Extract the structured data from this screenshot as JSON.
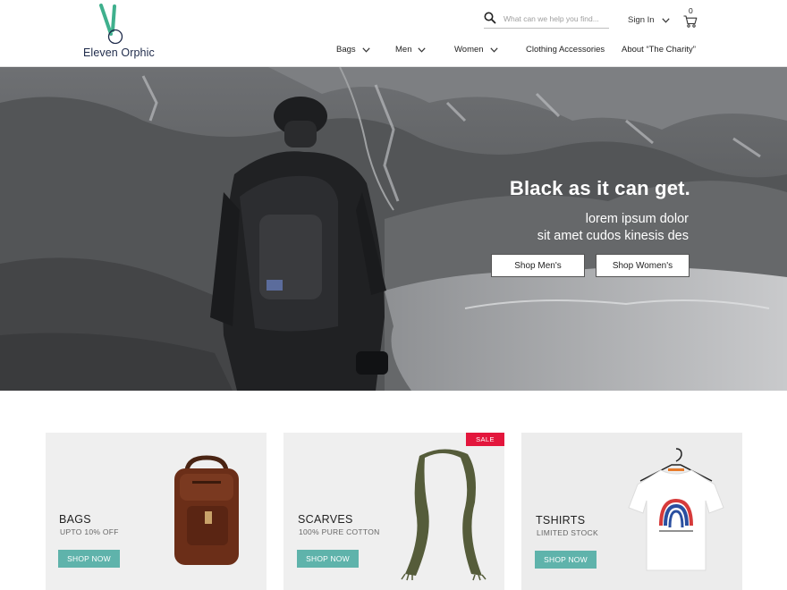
{
  "brand": {
    "name": "Eleven Orphic",
    "accent": "#3fb08d"
  },
  "header": {
    "search_placeholder": "What can we help you find...",
    "signin_label": "Sign In",
    "cart_count": "0"
  },
  "nav": {
    "items": [
      {
        "label": "Bags"
      },
      {
        "label": "Men"
      },
      {
        "label": "Women"
      },
      {
        "label": "Clothing Accessories"
      },
      {
        "label": "About “The Charity”"
      }
    ]
  },
  "hero": {
    "title": "Black as it can get.",
    "subtitle_line1": "lorem ipsum dolor",
    "subtitle_line2": "sit amet cudos kinesis des",
    "btn_men": "Shop Men's",
    "btn_women": "Shop Women's"
  },
  "cards": [
    {
      "title": "BAGS",
      "subtitle": "UPTO 10% OFF",
      "button": "SHOP NOW",
      "image_icon": "backpack-icon"
    },
    {
      "title": "SCARVES",
      "subtitle": "100% PURE COTTON",
      "button": "SHOP NOW",
      "badge": "SALE",
      "image_icon": "scarf-icon"
    },
    {
      "title": "TSHIRTS",
      "subtitle": "LIMITED STOCK",
      "button": "SHOP NOW",
      "image_icon": "tshirt-icon"
    }
  ],
  "colors": {
    "button_teal": "#5fb3ab",
    "sale_red": "#e3163c",
    "card_bg": "#efefef"
  }
}
